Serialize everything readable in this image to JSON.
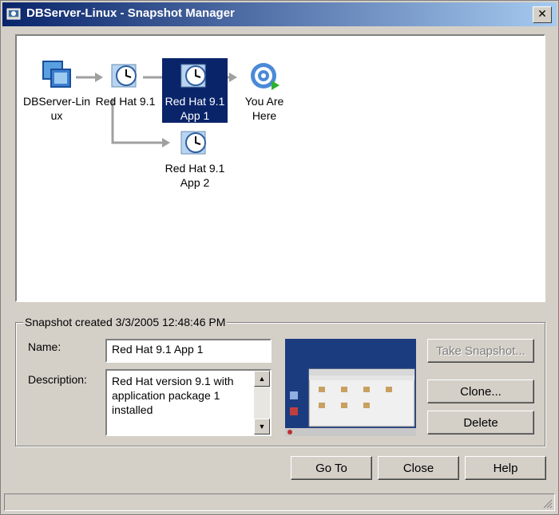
{
  "window": {
    "title": "DBServer-Linux - Snapshot Manager",
    "close_glyph": "✕"
  },
  "tree": {
    "nodes": [
      {
        "line1": "DBServer-Lin",
        "line2": "ux",
        "icon": "vm-icon"
      },
      {
        "line1": "Red Hat 9.1",
        "line2": "",
        "icon": "snapshot-clock-icon"
      },
      {
        "line1": "Red Hat 9.1",
        "line2": "App 1",
        "icon": "snapshot-clock-icon",
        "selected": true
      },
      {
        "line1": "You Are",
        "line2": "Here",
        "icon": "you-are-here-icon"
      },
      {
        "line1": "Red Hat 9.1",
        "line2": "App 2",
        "icon": "snapshot-clock-icon"
      }
    ]
  },
  "details": {
    "group_label": "Snapshot created 3/3/2005 12:48:46 PM",
    "name_label": "Name:",
    "name_value": "Red Hat 9.1 App 1",
    "description_label": "Description:",
    "description_value": "Red Hat version 9.1 with application package 1 installed"
  },
  "buttons": {
    "take_snapshot": "Take Snapshot...",
    "clone": "Clone...",
    "delete": "Delete",
    "go_to": "Go To",
    "close": "Close",
    "help": "Help"
  }
}
